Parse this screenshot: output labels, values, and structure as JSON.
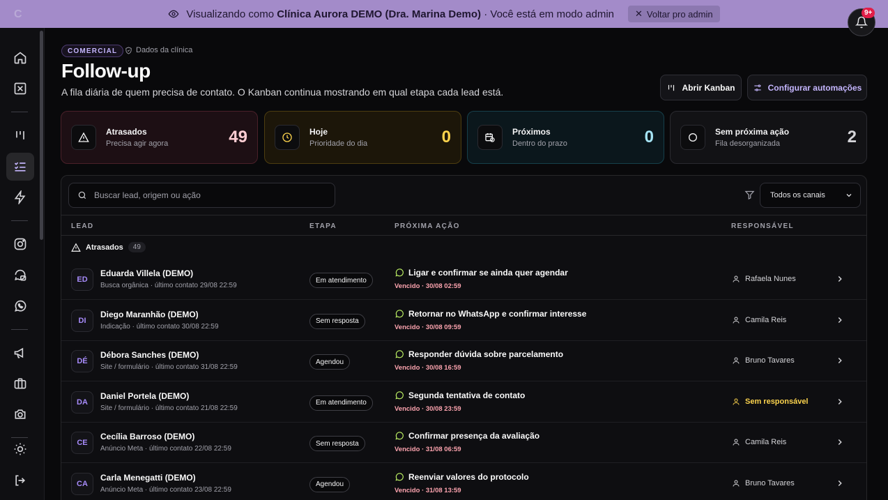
{
  "banner": {
    "logo": "C",
    "prefix": "Visualizando como",
    "clinic": "Clínica Aurora DEMO (Dra. Marina Demo)",
    "suffix": "· Você está em modo admin",
    "back_label": "Voltar pro admin"
  },
  "notifications": {
    "badge": "9+"
  },
  "header": {
    "tag": "COMERCIAL",
    "crumb": "Dados da clínica",
    "title": "Follow-up",
    "subtitle": "A fila diária de quem precisa de contato. O Kanban continua mostrando em qual etapa cada lead está.",
    "kanban_label": "Abrir Kanban",
    "automations_label": "Configurar automações"
  },
  "stats": [
    {
      "label": "Atrasados",
      "sub": "Precisa agir agora",
      "value": "49"
    },
    {
      "label": "Hoje",
      "sub": "Prioridade do dia",
      "value": "0"
    },
    {
      "label": "Próximos",
      "sub": "Dentro do prazo",
      "value": "0"
    },
    {
      "label": "Sem próxima ação",
      "sub": "Fila desorganizada",
      "value": "2"
    }
  ],
  "search": {
    "placeholder": "Buscar lead, origem ou ação"
  },
  "filter": {
    "selected": "Todos os canais"
  },
  "columns": {
    "lead": "LEAD",
    "stage": "ETAPA",
    "action": "PRÓXIMA AÇÃO",
    "owner": "RESPONSÁVEL"
  },
  "group": {
    "label": "Atrasados",
    "count": "49"
  },
  "rows": [
    {
      "initials": "ED",
      "name": "Eduarda Villela (DEMO)",
      "sub": "Busca orgânica · último contato 29/08 22:59",
      "stage": "Em atendimento",
      "action": "Ligar e confirmar se ainda quer agendar",
      "due": "Vencido · 30/08 02:59",
      "owner": "Rafaela Nunes"
    },
    {
      "initials": "DI",
      "name": "Diego Maranhão (DEMO)",
      "sub": "Indicação · último contato 30/08 22:59",
      "stage": "Sem resposta",
      "action": "Retornar no WhatsApp e confirmar interesse",
      "due": "Vencido · 30/08 09:59",
      "owner": "Camila Reis"
    },
    {
      "initials": "DÉ",
      "name": "Débora Sanches (DEMO)",
      "sub": "Site / formulário · último contato 31/08 22:59",
      "stage": "Agendou",
      "action": "Responder dúvida sobre parcelamento",
      "due": "Vencido · 30/08 16:59",
      "owner": "Bruno Tavares"
    },
    {
      "initials": "DA",
      "name": "Daniel Portela (DEMO)",
      "sub": "Site / formulário · último contato 21/08 22:59",
      "stage": "Em atendimento",
      "action": "Segunda tentativa de contato",
      "due": "Vencido · 30/08 23:59",
      "owner": "Sem responsável"
    },
    {
      "initials": "CE",
      "name": "Cecília Barroso (DEMO)",
      "sub": "Anúncio Meta · último contato 22/08 22:59",
      "stage": "Sem resposta",
      "action": "Confirmar presença da avaliação",
      "due": "Vencido · 31/08 06:59",
      "owner": "Camila Reis"
    },
    {
      "initials": "CA",
      "name": "Carla Menegatti (DEMO)",
      "sub": "Anúncio Meta · último contato 23/08 22:59",
      "stage": "Agendou",
      "action": "Reenviar valores do protocolo",
      "due": "Vencido · 31/08 13:59",
      "owner": "Bruno Tavares"
    }
  ],
  "colors": {
    "accent": "#a78bfa",
    "banner": "#a38bc9",
    "overdue": "#fda4af",
    "unassigned": "#fcd34d"
  }
}
